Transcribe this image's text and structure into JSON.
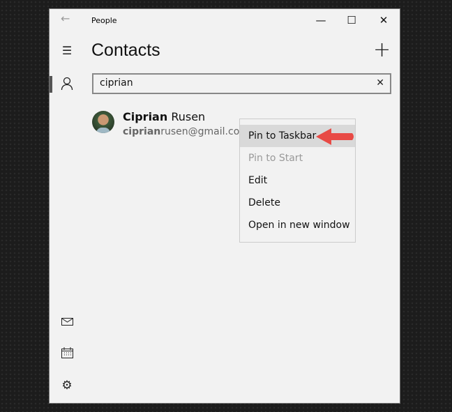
{
  "window": {
    "title": "People",
    "minimize": "—",
    "maximize": "☐",
    "close": "✕"
  },
  "header": {
    "title": "Contacts",
    "add": "+"
  },
  "search": {
    "value": "ciprian",
    "placeholder": "",
    "clear": "✕"
  },
  "contact": {
    "first": "Ciprian",
    "last": " Rusen",
    "email_bold": "ciprian",
    "email_rest": "rusen@gmail.com"
  },
  "context_menu": {
    "items": [
      {
        "label": "Pin to Taskbar",
        "state": "highlighted"
      },
      {
        "label": "Pin to Start",
        "state": "disabled"
      },
      {
        "label": "Edit"
      },
      {
        "label": "Delete"
      },
      {
        "label": "Open in new window"
      }
    ]
  },
  "annotation": {
    "arrow_color": "#e84a45"
  }
}
